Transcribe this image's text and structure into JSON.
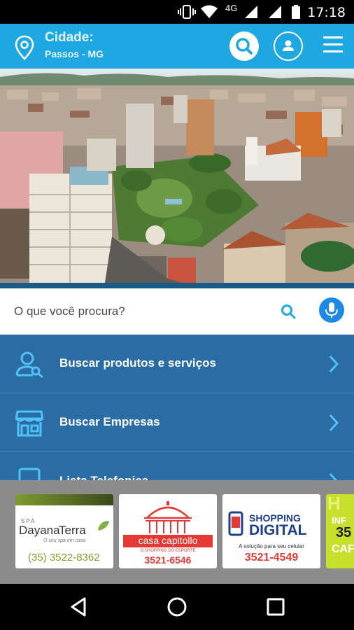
{
  "status_bar": {
    "time": "17:18",
    "network": "4G"
  },
  "header": {
    "city_label": "Cidade:",
    "city_value": "Passos - MG"
  },
  "search": {
    "placeholder": "O que você procura?"
  },
  "menu": {
    "items": [
      {
        "label": "Buscar produtos e serviços",
        "icon": "user-search-icon"
      },
      {
        "label": "Buscar Empresas",
        "icon": "store-icon"
      },
      {
        "label": "Lista Telefonica",
        "icon": "phone-book-icon"
      }
    ]
  },
  "ads": [
    {
      "brand_top": "SPA",
      "brand_a": "Dayana",
      "brand_b": "Terra",
      "tagline": "O seu spa em casa",
      "phone": "(35) 3522-8362"
    },
    {
      "brand": "casa capitollo",
      "tagline": "O SHOPPING DO ESPORTE",
      "phone": "3521-6546"
    },
    {
      "brand_a": "SHOPPING",
      "brand_b": "DIGITAL",
      "tagline": "A solução para seu celular",
      "phone": "3521-4549"
    },
    {
      "line1": "H",
      "line2": "INF",
      "line3": "35",
      "line4": "CAF"
    }
  ],
  "colors": {
    "header": "#1ea7e1",
    "menu": "#2a6ca3",
    "accent": "#1e88e5"
  }
}
